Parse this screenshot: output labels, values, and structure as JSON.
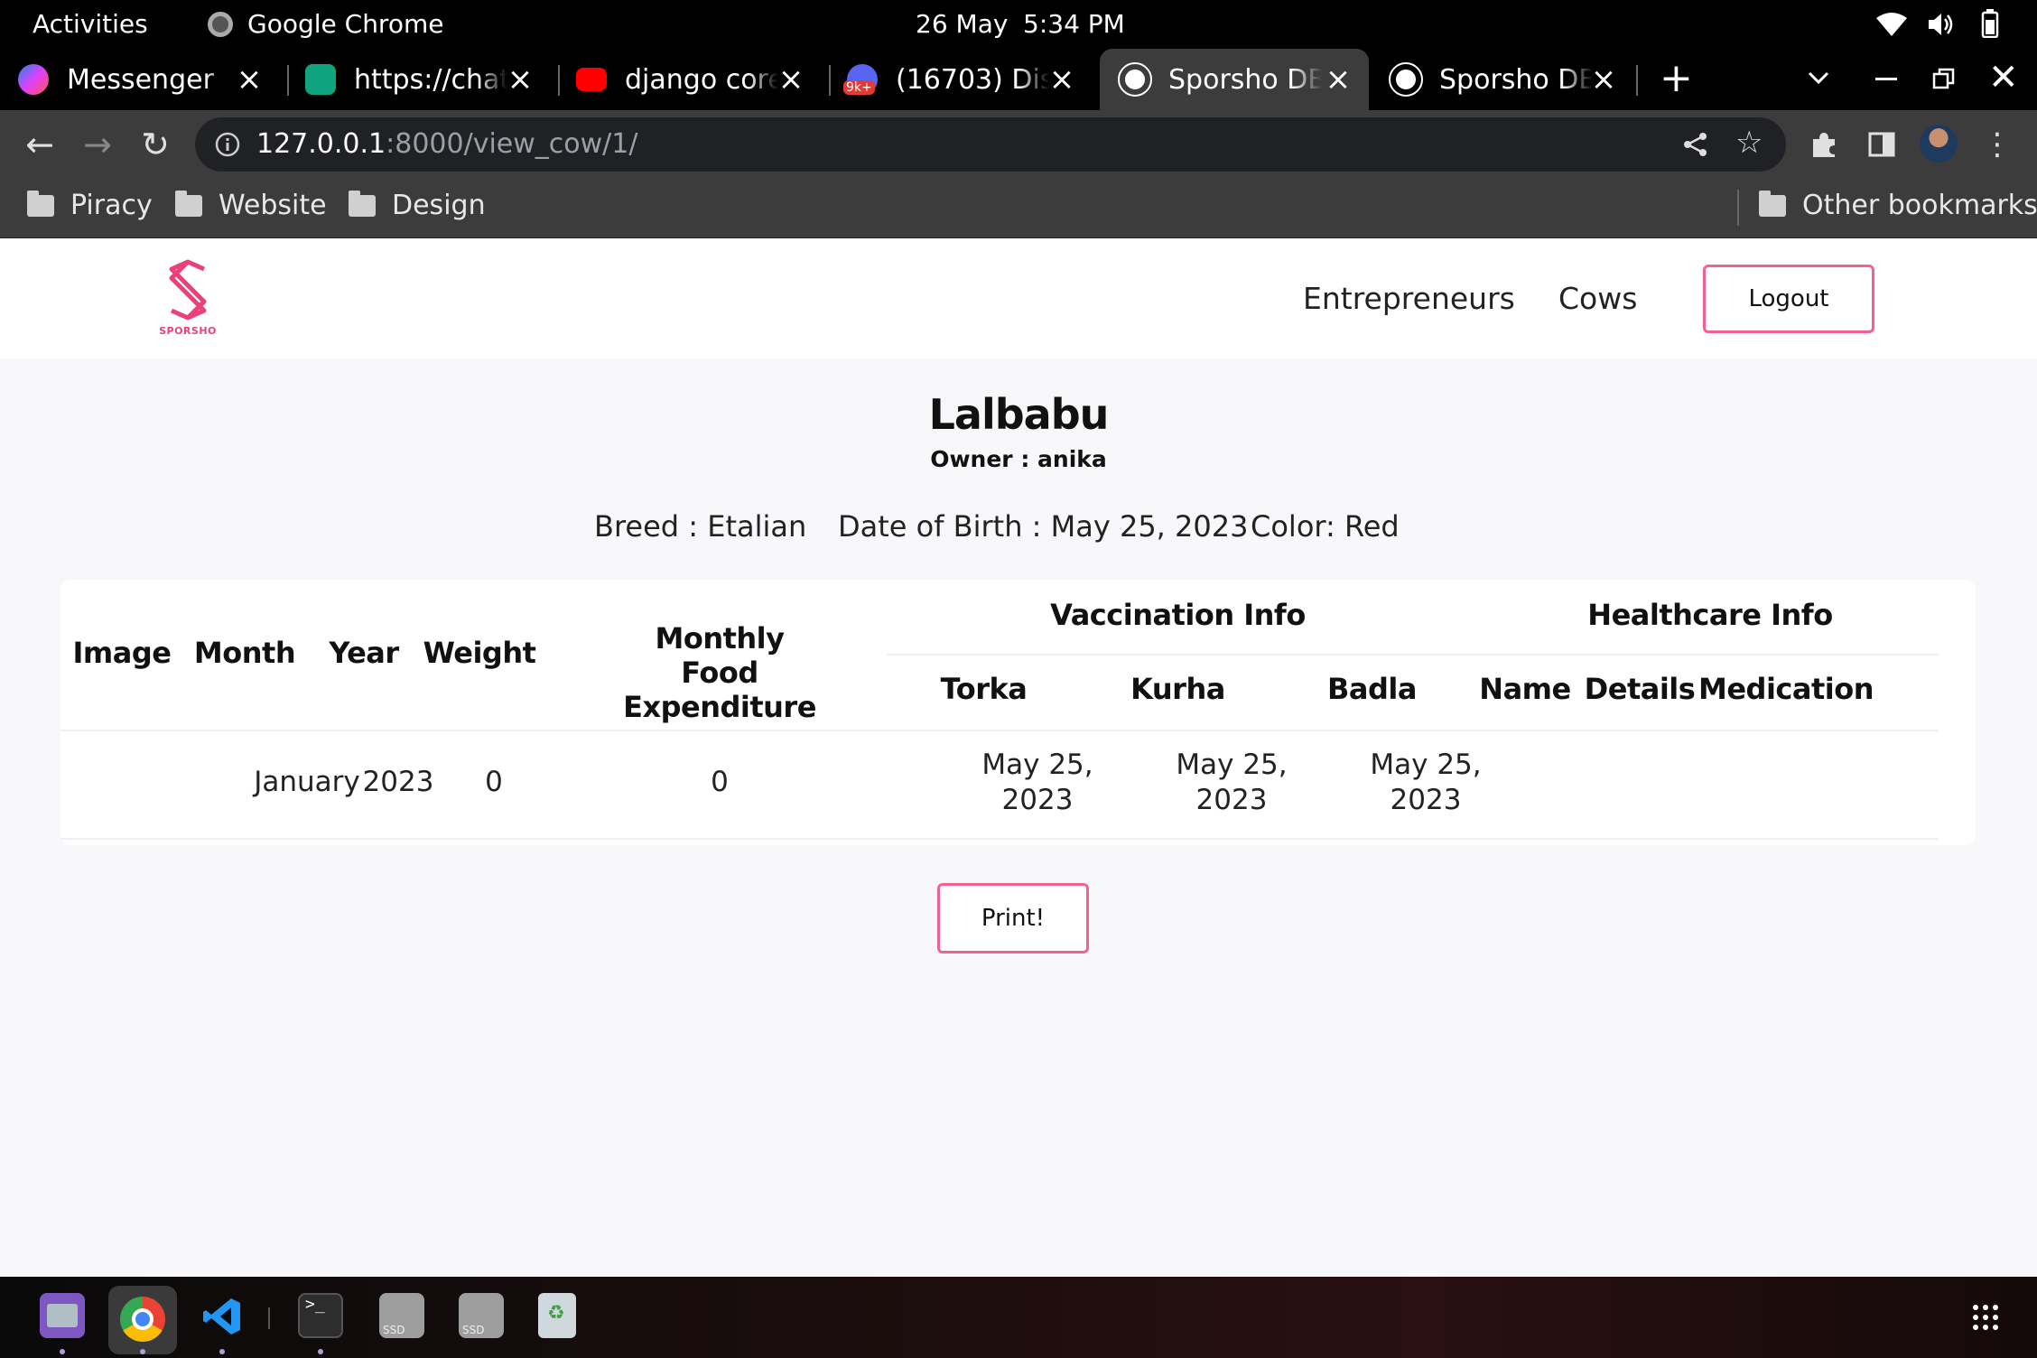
{
  "system": {
    "activities": "Activities",
    "app_name": "Google Chrome",
    "date": "26 May",
    "time": "5:34 PM"
  },
  "tabs": [
    {
      "title": "Messenger",
      "favicon": "messenger-icon"
    },
    {
      "title": "https://chat.",
      "favicon": "chatgpt-icon"
    },
    {
      "title": "django corey",
      "favicon": "youtube-icon"
    },
    {
      "title": "(16703) Disc",
      "favicon": "discord-icon",
      "badge": "9k+"
    },
    {
      "title": "Sporsho DBM",
      "favicon": "globe-icon",
      "active": true
    },
    {
      "title": "Sporsho DBM",
      "favicon": "globe-icon"
    }
  ],
  "address_bar": {
    "host": "127.0.0.1",
    "path": ":8000/view_cow/1/"
  },
  "bookmarks": [
    "Piracy",
    "Website",
    "Design"
  ],
  "other_bookmarks": "Other bookmarks",
  "site": {
    "logo_text": "SPORSHO",
    "nav": {
      "entrepreneurs": "Entrepreneurs",
      "cows": "Cows",
      "logout": "Logout"
    }
  },
  "cow": {
    "name": "Lalbabu",
    "owner": "Owner : anika",
    "breed": "Breed : Etalian",
    "dob": "Date of Birth : May 25, 2023",
    "color": "Color: Red"
  },
  "table": {
    "headers": {
      "image": "Image",
      "month": "Month",
      "year": "Year",
      "weight": "Weight",
      "food": "Monthly Food Expenditure",
      "vaccination": "Vaccination Info",
      "healthcare": "Healthcare Info",
      "torka": "Torka",
      "kurha": "Kurha",
      "badla": "Badla",
      "name": "Name",
      "details": "Details",
      "medication": "Medication"
    },
    "rows": [
      {
        "image": "",
        "month": "January",
        "year": "2023",
        "weight": "0",
        "food": "0",
        "torka": "May 25, 2023",
        "kurha": "May 25, 2023",
        "badla": "May 25, 2023",
        "name": "",
        "details": "",
        "medication": ""
      }
    ]
  },
  "print_button": "Print!",
  "colors": {
    "accent": "#f06292",
    "chrome_dark": "#3c3c3c"
  }
}
